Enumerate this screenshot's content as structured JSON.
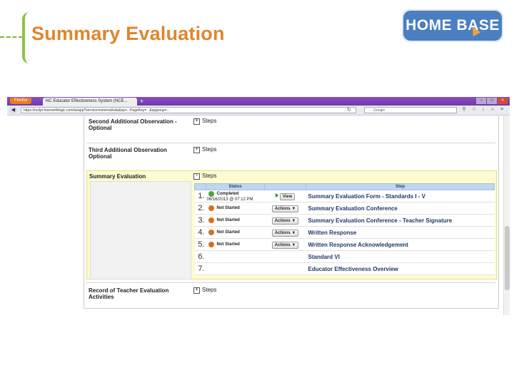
{
  "slide": {
    "title": "Summary Evaluation",
    "logo_text": "HOME BASE"
  },
  "browser": {
    "firefox_label": "Firefox",
    "tab_title": "NC Educator Effectiveness System (NCE...",
    "tab_add": "+",
    "url": "https://ncdpi.truenorthlogic.com/ia/app?service=external/sdu&sp=...PageKey=...&spgroup=...",
    "search_placeholder": "Google",
    "window_controls": [
      "–",
      "□",
      "×"
    ]
  },
  "sections": [
    {
      "label": "Second Additional Observation - Optional",
      "steps_label": "Steps",
      "expander": "+"
    },
    {
      "label": "Third Additional Observation Optional",
      "steps_label": "Steps",
      "expander": "+"
    },
    {
      "label": "Summary Evaluation",
      "steps_label": "Steps",
      "expander": "−"
    },
    {
      "label": "Record of Teacher Evaluation Activities",
      "steps_label": "Steps",
      "expander": "+"
    }
  ],
  "table": {
    "headers": {
      "status": "Status",
      "step": "Step"
    },
    "rows": [
      {
        "num": "1.",
        "status": "Completed",
        "date": "06/16/2013 @ 07:12 PM",
        "action": "View",
        "step": "Summary Evaluation Form - Standards I - V",
        "state": "ok"
      },
      {
        "num": "2.",
        "status": "Not Started",
        "date": "",
        "action": "Actions ▼",
        "step": "Summary Evaluation Conference",
        "state": "pending"
      },
      {
        "num": "3.",
        "status": "Not Started",
        "date": "",
        "action": "Actions ▼",
        "step": "Summary Evaluation Conference - Teacher Signature",
        "state": "pending"
      },
      {
        "num": "4.",
        "status": "Not Started",
        "date": "",
        "action": "Actions ▼",
        "step": "Written Response",
        "state": "pending"
      },
      {
        "num": "5.",
        "status": "Not Started",
        "date": "",
        "action": "Actions ▼",
        "step": "Written Response Acknowledgement",
        "state": "pending"
      },
      {
        "num": "6.",
        "status": "",
        "date": "",
        "action": "",
        "step": "Standard VI",
        "state": "none"
      },
      {
        "num": "7.",
        "status": "",
        "date": "",
        "action": "",
        "step": "Educator Effectiveness Overview",
        "state": "none"
      }
    ]
  },
  "colors": {
    "title": "#e0852c",
    "accent_green": "#8bc34a",
    "logo_blue": "#4a7fc1",
    "highlight": "#fdfbd0",
    "step_text": "#1e3a66"
  }
}
